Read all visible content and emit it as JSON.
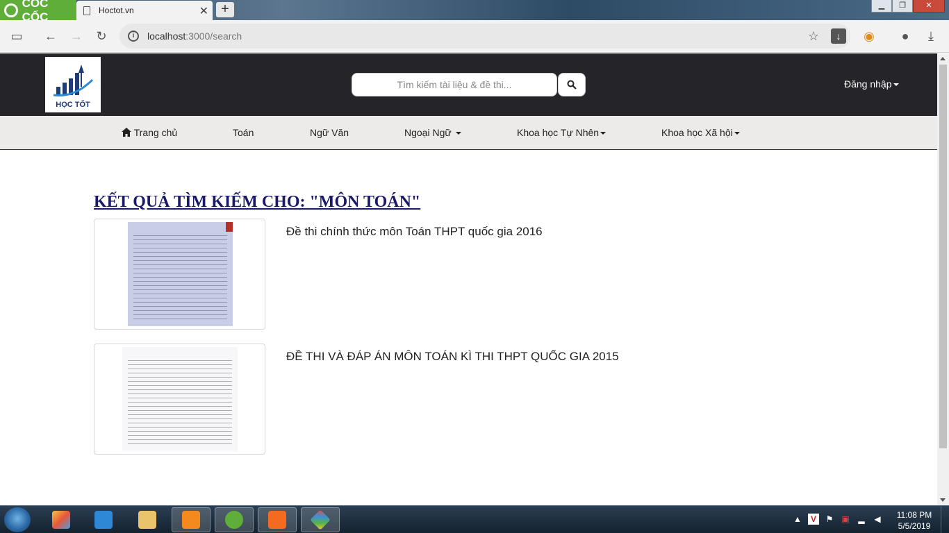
{
  "browser": {
    "brand": "CỐC CỐC",
    "tab_title": "Hoctot.vn",
    "url_host": "localhost",
    "url_rest": ":3000/search"
  },
  "site": {
    "logo_text": "HỌC TỐT",
    "search_placeholder": "Tìm kiếm tài liệu & đề thi...",
    "login_label": "Đăng nhập"
  },
  "menu": {
    "items": [
      {
        "label": "Trang chủ",
        "icon": "home-icon"
      },
      {
        "label": "Toán"
      },
      {
        "label": "Ngữ Văn"
      },
      {
        "label": "Ngoại Ngữ",
        "dropdown": true
      },
      {
        "label": "Khoa học Tự Nhên",
        "dropdown": true
      },
      {
        "label": "Khoa học Xã hội",
        "dropdown": true
      }
    ]
  },
  "results": {
    "heading": "KẾT QUẢ TÌM KIẾM CHO: \"MÔN TOÁN\"",
    "items": [
      {
        "title": "Đề thi chính thức môn Toán THPT quốc gia 2016"
      },
      {
        "title": "ĐỀ THI VÀ ĐÁP ÁN MÔN TOÁN KÌ THI THPT QUỐC GIA 2015"
      }
    ]
  },
  "taskbar": {
    "time": "11:08 PM",
    "date": "5/5/2019"
  },
  "colors": {
    "header_bg": "#252428",
    "menu_bg": "#edebea",
    "heading": "#1b1a6a",
    "brand_green": "#5fae3a"
  }
}
